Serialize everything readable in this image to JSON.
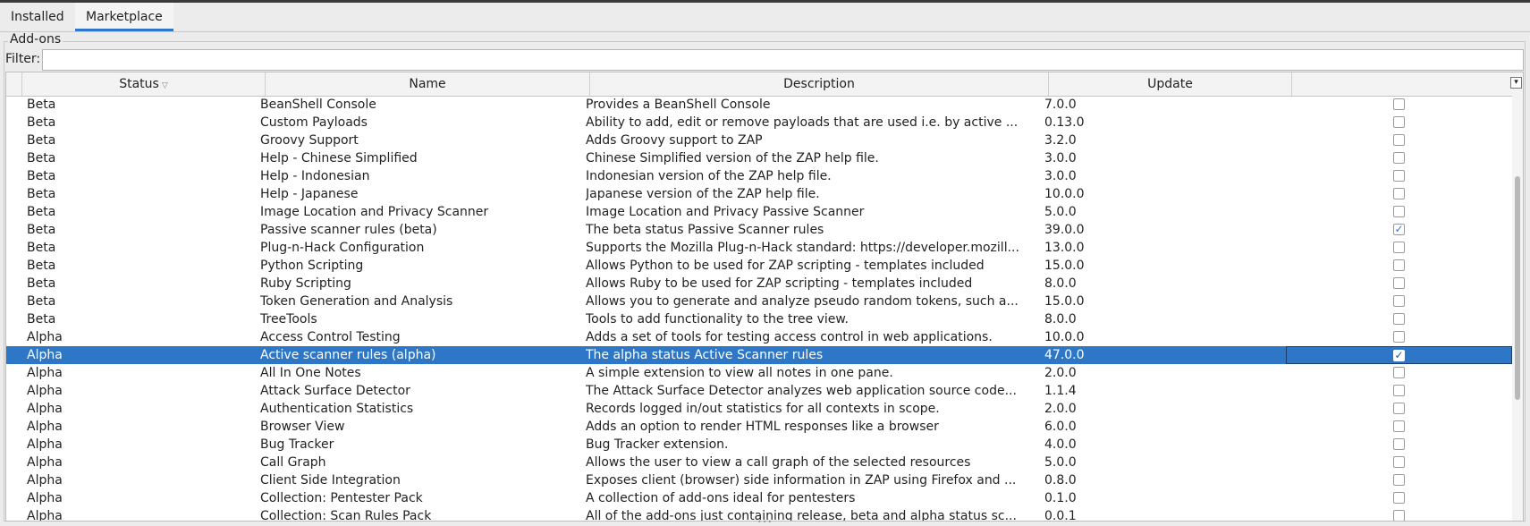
{
  "tabs": [
    {
      "label": "Installed"
    },
    {
      "label": "Marketplace"
    }
  ],
  "group_title": "Add-ons",
  "filter": {
    "label": "Filter:",
    "value": ""
  },
  "columns": [
    {
      "label": "Status",
      "sorted": "descending"
    },
    {
      "label": "Name"
    },
    {
      "label": "Description"
    },
    {
      "label": "Update"
    },
    {
      "label": ""
    }
  ],
  "rows": [
    {
      "status": "Beta",
      "name": "BeanShell Console",
      "description": "Provides a BeanShell Console",
      "update": "7.0.0",
      "checked": false
    },
    {
      "status": "Beta",
      "name": "Custom Payloads",
      "description": "Ability to add, edit or remove payloads that are used i.e. by active ...",
      "update": "0.13.0",
      "checked": false
    },
    {
      "status": "Beta",
      "name": "Groovy Support",
      "description": "Adds Groovy support to ZAP",
      "update": "3.2.0",
      "checked": false
    },
    {
      "status": "Beta",
      "name": "Help - Chinese Simplified",
      "description": "Chinese Simplified version of the ZAP help file.",
      "update": "3.0.0",
      "checked": false
    },
    {
      "status": "Beta",
      "name": "Help - Indonesian",
      "description": "Indonesian version of the ZAP help file.",
      "update": "3.0.0",
      "checked": false
    },
    {
      "status": "Beta",
      "name": "Help - Japanese",
      "description": "Japanese version of the ZAP help file.",
      "update": "10.0.0",
      "checked": false
    },
    {
      "status": "Beta",
      "name": "Image Location and Privacy Scanner",
      "description": "Image Location and Privacy Passive Scanner",
      "update": "5.0.0",
      "checked": false
    },
    {
      "status": "Beta",
      "name": "Passive scanner rules (beta)",
      "description": "The beta status Passive Scanner rules",
      "update": "39.0.0",
      "checked": true
    },
    {
      "status": "Beta",
      "name": "Plug-n-Hack Configuration",
      "description": "Supports the Mozilla Plug-n-Hack standard: https://developer.mozill...",
      "update": "13.0.0",
      "checked": false
    },
    {
      "status": "Beta",
      "name": "Python Scripting",
      "description": "Allows Python to be used for ZAP scripting - templates included",
      "update": "15.0.0",
      "checked": false
    },
    {
      "status": "Beta",
      "name": "Ruby Scripting",
      "description": "Allows Ruby to be used for ZAP scripting - templates included",
      "update": "8.0.0",
      "checked": false
    },
    {
      "status": "Beta",
      "name": "Token Generation and Analysis",
      "description": "Allows you to generate and analyze pseudo random tokens, such a...",
      "update": "15.0.0",
      "checked": false
    },
    {
      "status": "Beta",
      "name": "TreeTools",
      "description": "Tools to add functionality to the tree view.",
      "update": "8.0.0",
      "checked": false
    },
    {
      "status": "Alpha",
      "name": "Access Control Testing",
      "description": "Adds a set of tools for testing access control in web applications.",
      "update": "10.0.0",
      "checked": false
    },
    {
      "status": "Alpha",
      "name": "Active scanner rules (alpha)",
      "description": "The alpha status Active Scanner rules",
      "update": "47.0.0",
      "checked": true,
      "selected": true
    },
    {
      "status": "Alpha",
      "name": "All In One Notes",
      "description": "A simple extension to view all notes in one pane.",
      "update": "2.0.0",
      "checked": false
    },
    {
      "status": "Alpha",
      "name": "Attack Surface Detector",
      "description": "The Attack Surface Detector analyzes web application source code...",
      "update": "1.1.4",
      "checked": false
    },
    {
      "status": "Alpha",
      "name": "Authentication Statistics",
      "description": "Records logged in/out statistics for all contexts in scope.",
      "update": "2.0.0",
      "checked": false
    },
    {
      "status": "Alpha",
      "name": "Browser View",
      "description": "Adds an option to render HTML responses like a browser",
      "update": "6.0.0",
      "checked": false
    },
    {
      "status": "Alpha",
      "name": "Bug Tracker",
      "description": "Bug Tracker extension.",
      "update": "4.0.0",
      "checked": false
    },
    {
      "status": "Alpha",
      "name": "Call Graph",
      "description": "Allows the user to view a call graph of the selected resources",
      "update": "5.0.0",
      "checked": false
    },
    {
      "status": "Alpha",
      "name": "Client Side Integration",
      "description": "Exposes client (browser) side information in ZAP using Firefox and ...",
      "update": "0.8.0",
      "checked": false
    },
    {
      "status": "Alpha",
      "name": "Collection: Pentester Pack",
      "description": "A collection of add-ons ideal for pentesters",
      "update": "0.1.0",
      "checked": false
    },
    {
      "status": "Alpha",
      "name": "Collection: Scan Rules Pack",
      "description": "All of the add-ons just containing release, beta and alpha status sc...",
      "update": "0.0.1",
      "checked": false
    }
  ]
}
